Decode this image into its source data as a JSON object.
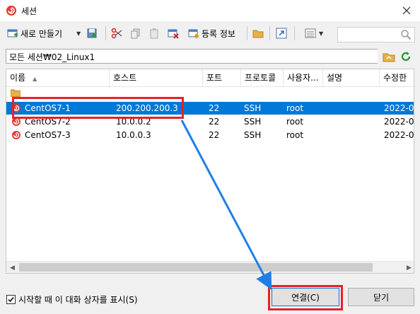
{
  "window": {
    "title": "세션"
  },
  "toolbar": {
    "new_label": "새로 만들기",
    "register_label": "등록 정보",
    "search_placeholder": ""
  },
  "path": {
    "text": "모든 세션₩02_Linux1"
  },
  "columns": [
    "이름",
    "호스트",
    "포트",
    "프로토콜",
    "사용자...",
    "설명",
    "수정한"
  ],
  "sessions": [
    {
      "name": "CentOS7-1",
      "host": "200.200.200.3",
      "port": "22",
      "protocol": "SSH",
      "user": "root",
      "desc": "",
      "modified": "2022-0",
      "selected": true
    },
    {
      "name": "CentOS7-2",
      "host": "10.0.0.2",
      "port": "22",
      "protocol": "SSH",
      "user": "root",
      "desc": "",
      "modified": "2022-0",
      "selected": false
    },
    {
      "name": "CentOS7-3",
      "host": "10.0.0.3",
      "port": "22",
      "protocol": "SSH",
      "user": "root",
      "desc": "",
      "modified": "2022-0",
      "selected": false
    }
  ],
  "footer": {
    "startup_checkbox_label": "시작할 때 이 대화 상자를 표시(S)",
    "startup_checked": true,
    "connect_label": "연결(C)",
    "close_label": "닫기"
  },
  "colors": {
    "selection": "#0078d7",
    "annotation_red": "#e8202a",
    "annotation_arrow": "#1f7fe8"
  }
}
